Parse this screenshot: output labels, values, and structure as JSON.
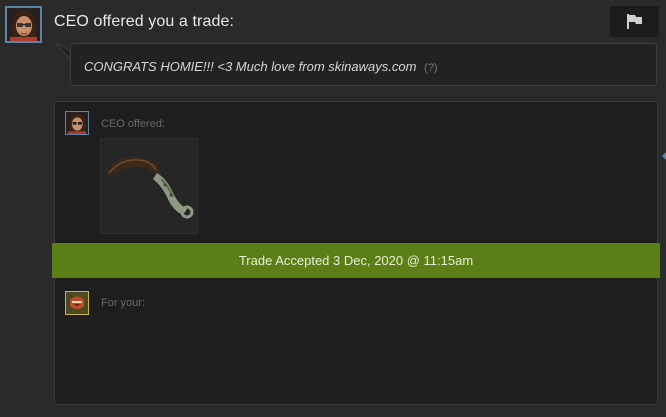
{
  "header": {
    "title": "CEO offered you a trade:",
    "avatar_icon": "user-avatar-icon",
    "report_icon": "flag-icon"
  },
  "message": {
    "text": "CONGRATS HOMIE!!! <3 Much love from skinaways.com",
    "help": "(?)"
  },
  "trade": {
    "their_label": "CEO offered:",
    "their_items": [
      {
        "icon": "karambit-knife-icon"
      }
    ],
    "status": "Trade Accepted 3 Dec, 2020 @ 11:15am",
    "your_label": "For your:",
    "your_items": []
  },
  "colors": {
    "background": "#2a2a2a",
    "panel": "#1e1e1e",
    "accepted_green": "#5b7f16",
    "avatar_border": "#5a87a8"
  }
}
